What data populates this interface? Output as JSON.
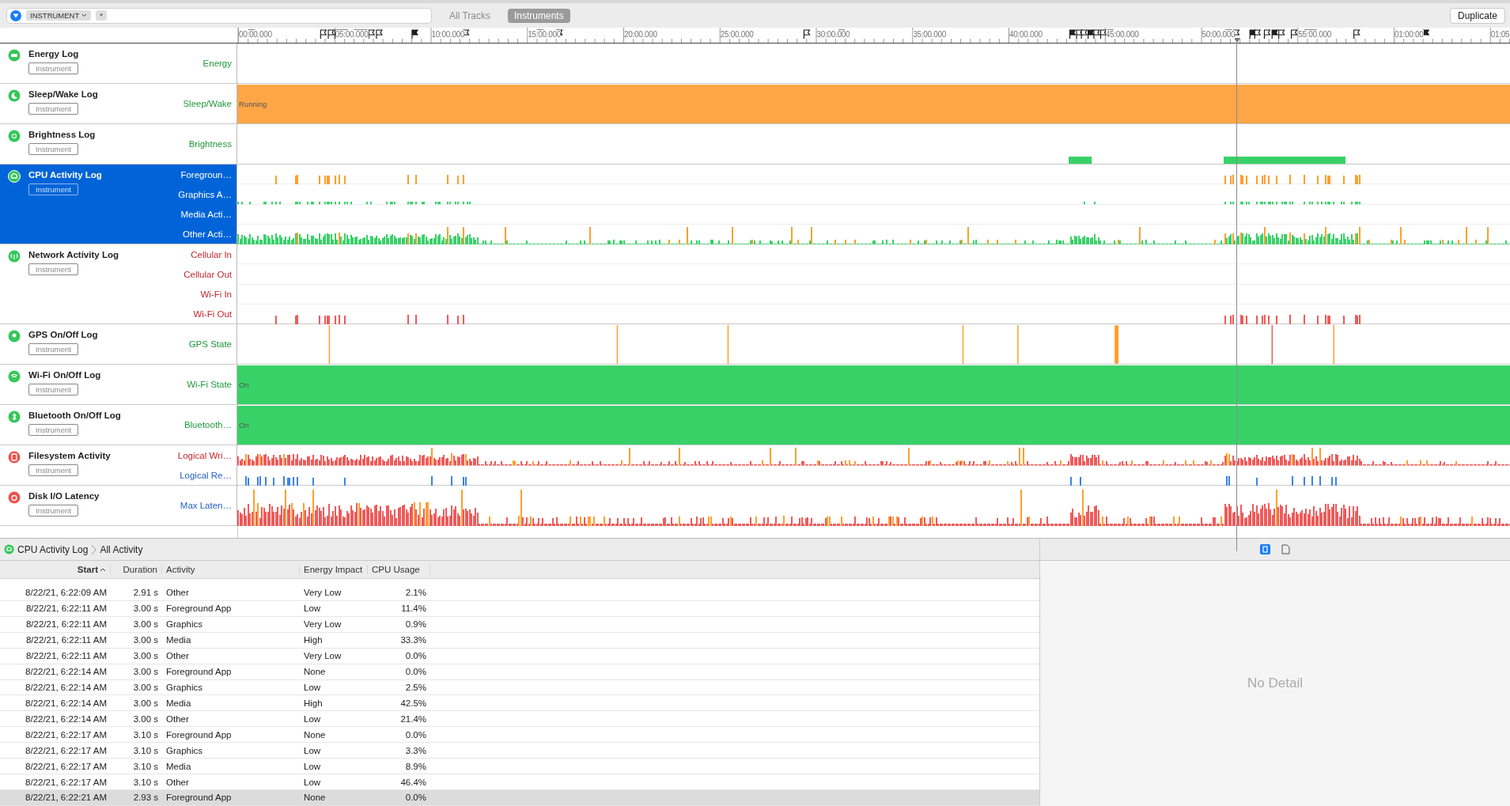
{
  "toolbar": {
    "filter": {
      "token": "INSTRUMENT",
      "value": "*"
    },
    "scope_tabs": [
      {
        "label": "All Tracks",
        "selected": false
      },
      {
        "label": "Instruments",
        "selected": true
      }
    ],
    "duplicate_button": "Duplicate"
  },
  "ruler": {
    "labels": [
      "00:00.000",
      "05:00.000",
      "10:00.000",
      "15:00.000",
      "20:00.000",
      "25:00.000",
      "30:00.000",
      "35:00.000",
      "40:00.000",
      "45:00.000",
      "50:00.000",
      "55:00.000",
      "01:00:00",
      "01:05"
    ]
  },
  "tracks": [
    {
      "title": "Energy Log",
      "badge": "Instrument",
      "color": "#34c759",
      "selected": false,
      "lanes": [
        {
          "label": {
            "text": "Energy",
            "color": "#1f9a3c"
          },
          "graph": {
            "kind": "empty"
          }
        }
      ]
    },
    {
      "title": "Sleep/Wake Log",
      "badge": "Instrument",
      "color": "#34c759",
      "selected": false,
      "lanes": [
        {
          "label": {
            "text": "Sleep/Wake",
            "color": "#1f9a3c"
          },
          "graph": {
            "kind": "band",
            "color": "#ffa647",
            "text": "Running"
          }
        }
      ]
    },
    {
      "title": "Brightness Log",
      "badge": "Instrument",
      "color": "#34c759",
      "selected": false,
      "lanes": [
        {
          "label": {
            "text": "Brightness",
            "color": "#1f9a3c"
          },
          "graph": {
            "kind": "blocks",
            "color": "#38d168"
          }
        }
      ]
    },
    {
      "title": "CPU Activity Log",
      "badge": "Instrument",
      "color": "#34c759",
      "selected": true,
      "lanes": [
        {
          "label": {
            "text": "Foregroun…"
          },
          "graph": {
            "kind": "sparse",
            "color": "#ff9f2e"
          }
        },
        {
          "label": {
            "text": "Graphics A…"
          },
          "graph": {
            "kind": "dots",
            "color": "#38d168"
          }
        },
        {
          "label": {
            "text": "Media Acti…"
          },
          "graph": {
            "kind": "empty"
          }
        },
        {
          "label": {
            "text": "Other Acti…"
          },
          "graph": {
            "kind": "dense",
            "color": "#38d168"
          }
        }
      ]
    },
    {
      "title": "Network Activity Log",
      "badge": "Instrument",
      "color": "#34c759",
      "selected": false,
      "lanes": [
        {
          "label": {
            "text": "Cellular In",
            "color": "#c0272d"
          },
          "graph": {
            "kind": "empty"
          }
        },
        {
          "label": {
            "text": "Cellular Out",
            "color": "#c0272d"
          },
          "graph": {
            "kind": "empty"
          }
        },
        {
          "label": {
            "text": "Wi-Fi In",
            "color": "#c0272d"
          },
          "graph": {
            "kind": "empty"
          }
        },
        {
          "label": {
            "text": "Wi-Fi Out",
            "color": "#c0272d"
          },
          "graph": {
            "kind": "sparse",
            "color": "#f05a5a"
          }
        }
      ]
    },
    {
      "title": "GPS On/Off Log",
      "badge": "Instrument",
      "color": "#34c759",
      "selected": false,
      "lanes": [
        {
          "label": {
            "text": "GPS State",
            "color": "#1f9a3c"
          },
          "graph": {
            "kind": "marks",
            "color": "#ff9f2e"
          }
        }
      ]
    },
    {
      "title": "Wi-Fi On/Off Log",
      "badge": "Instrument",
      "color": "#34c759",
      "selected": false,
      "lanes": [
        {
          "label": {
            "text": "Wi-Fi State",
            "color": "#1f9a3c"
          },
          "graph": {
            "kind": "band",
            "color": "#38d168",
            "text": "On"
          }
        }
      ]
    },
    {
      "title": "Bluetooth On/Off Log",
      "badge": "Instrument",
      "color": "#34c759",
      "selected": false,
      "lanes": [
        {
          "label": {
            "text": "Bluetooth…",
            "color": "#1f9a3c"
          },
          "graph": {
            "kind": "band",
            "color": "#38d168",
            "text": "On"
          }
        }
      ]
    },
    {
      "title": "Filesystem Activity",
      "badge": "Instrument",
      "color": "#f0524f",
      "selected": false,
      "lanes": [
        {
          "label": {
            "text": "Logical Wri…",
            "color": "#c0272d"
          },
          "graph": {
            "kind": "dense",
            "color": "#f05a5a"
          }
        },
        {
          "label": {
            "text": "Logical Re…",
            "color": "#2360c2"
          },
          "graph": {
            "kind": "sparse",
            "color": "#3b82f0"
          }
        }
      ]
    },
    {
      "title": "Disk I/O Latency",
      "badge": "Instrument",
      "color": "#f0524f",
      "selected": false,
      "lanes": [
        {
          "label": {
            "text": "Max Laten…",
            "color": "#2360c2"
          },
          "graph": {
            "kind": "dense",
            "color": "#f05a5a"
          }
        }
      ]
    }
  ],
  "detail": {
    "breadcrumb": [
      "CPU Activity Log",
      "All Activity"
    ],
    "columns": [
      "Start",
      "Duration",
      "Activity",
      "Energy Impact",
      "CPU Usage"
    ],
    "rows": [
      {
        "cells": [
          "8/22/21, 6:22:09 AM",
          "2.91 s",
          "Other",
          "Very Low",
          "2.1%"
        ],
        "selected": false
      },
      {
        "cells": [
          "8/22/21, 6:22:11 AM",
          "3.00 s",
          "Foreground App",
          "Low",
          "11.4%"
        ],
        "selected": false
      },
      {
        "cells": [
          "8/22/21, 6:22:11 AM",
          "3.00 s",
          "Graphics",
          "Very Low",
          "0.9%"
        ],
        "selected": false
      },
      {
        "cells": [
          "8/22/21, 6:22:11 AM",
          "3.00 s",
          "Media",
          "High",
          "33.3%"
        ],
        "selected": false
      },
      {
        "cells": [
          "8/22/21, 6:22:11 AM",
          "3.00 s",
          "Other",
          "Very Low",
          "0.0%"
        ],
        "selected": false
      },
      {
        "cells": [
          "8/22/21, 6:22:14 AM",
          "3.00 s",
          "Foreground App",
          "None",
          "0.0%"
        ],
        "selected": false
      },
      {
        "cells": [
          "8/22/21, 6:22:14 AM",
          "3.00 s",
          "Graphics",
          "Low",
          "2.5%"
        ],
        "selected": false
      },
      {
        "cells": [
          "8/22/21, 6:22:14 AM",
          "3.00 s",
          "Media",
          "High",
          "42.5%"
        ],
        "selected": false
      },
      {
        "cells": [
          "8/22/21, 6:22:14 AM",
          "3.00 s",
          "Other",
          "Low",
          "21.4%"
        ],
        "selected": false
      },
      {
        "cells": [
          "8/22/21, 6:22:17 AM",
          "3.10 s",
          "Foreground App",
          "None",
          "0.0%"
        ],
        "selected": false
      },
      {
        "cells": [
          "8/22/21, 6:22:17 AM",
          "3.10 s",
          "Graphics",
          "Low",
          "3.3%"
        ],
        "selected": false
      },
      {
        "cells": [
          "8/22/21, 6:22:17 AM",
          "3.10 s",
          "Media",
          "Low",
          "8.9%"
        ],
        "selected": false
      },
      {
        "cells": [
          "8/22/21, 6:22:17 AM",
          "3.10 s",
          "Other",
          "Low",
          "46.4%"
        ],
        "selected": false
      },
      {
        "cells": [
          "8/22/21, 6:22:21 AM",
          "2.93 s",
          "Foreground App",
          "None",
          "0.0%"
        ],
        "selected": true
      }
    ],
    "empty_detail": "No Detail"
  }
}
